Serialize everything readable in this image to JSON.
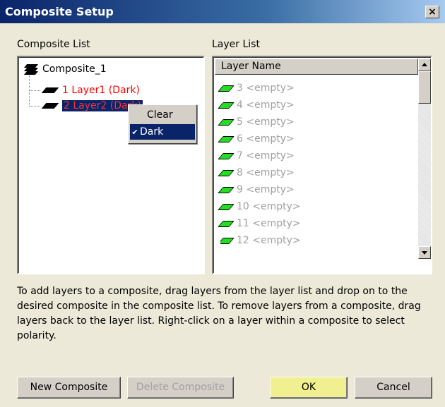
{
  "window": {
    "title": "Composite Setup",
    "close_label": "×"
  },
  "composite_list": {
    "label": "Composite List",
    "root": {
      "label": "Composite_1"
    },
    "items": [
      {
        "label": "1 Layer1 (Dark)"
      },
      {
        "label": "2 Layer2 (Dark)"
      }
    ]
  },
  "context_menu": {
    "items": [
      {
        "label": "Clear",
        "checked": false
      },
      {
        "label": "Dark",
        "checked": true,
        "check_mark": "✔"
      }
    ]
  },
  "layer_list": {
    "label": "Layer List",
    "column_header": "Layer Name",
    "rows": [
      "3 <empty>",
      "4 <empty>",
      "5 <empty>",
      "6 <empty>",
      "7 <empty>",
      "8 <empty>",
      "9 <empty>",
      "10 <empty>",
      "11 <empty>",
      "12 <empty>"
    ]
  },
  "instructions": "To add layers to a composite, drag layers from the layer list and drop on to the desired composite in the composite list.  To remove layers from a composite, drag layers back to the layer list.  Right-click on a layer within a composite to select polarity.",
  "buttons": {
    "new_composite": "New Composite",
    "delete_composite": "Delete Composite",
    "ok": "OK",
    "cancel": "Cancel"
  },
  "colors": {
    "title_bar": "#0a246a",
    "selection": "#0a246a",
    "layer_text": "#ff0000",
    "empty_layer_icon": "#22dd22",
    "ok_button": "#f0f090"
  }
}
